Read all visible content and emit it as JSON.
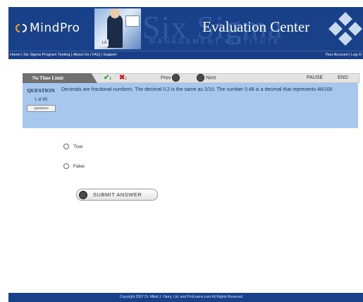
{
  "header": {
    "logo_text": "MindPro",
    "title": "Evaluation Center",
    "background_text": "Six Sigma",
    "background_subtext": "MANAGEMENT INSTITUTE",
    "photo_caption": "LA"
  },
  "nav": {
    "left_items": [
      "Home",
      "Six Sigma Program Testing",
      "About Us",
      "FAQ",
      "Support"
    ],
    "separator": " | ",
    "right_items": [
      "Your Account",
      "Log O"
    ]
  },
  "toolbar": {
    "time_label": "No Time Limit",
    "correct_count": "1",
    "wrong_count": "1",
    "prev_label": "Prev",
    "next_label": "Next",
    "pause_label": "PAUSE",
    "end_label": "END"
  },
  "question": {
    "label": "QUESTION",
    "count": "1 of 85",
    "questions_button": "Questions",
    "text": "Decimals are fractional numbers. The decimal 0.2 is the same as 2/10. The number 0.48 is a decimal that represents 48/100"
  },
  "options": [
    "True",
    "False"
  ],
  "submit_label": "SUBMIT ANSWER",
  "footer_text": "Copyright 2007 Dr. Mikel J. Harry, Ltd. and ProExams.com All Rights Reserved",
  "colors": {
    "header_bg": "#18418a",
    "question_panel": "#a8c7ef",
    "toolbar_tab": "#707070",
    "check_green": "#3ba421",
    "cross_red": "#d11b1b"
  }
}
